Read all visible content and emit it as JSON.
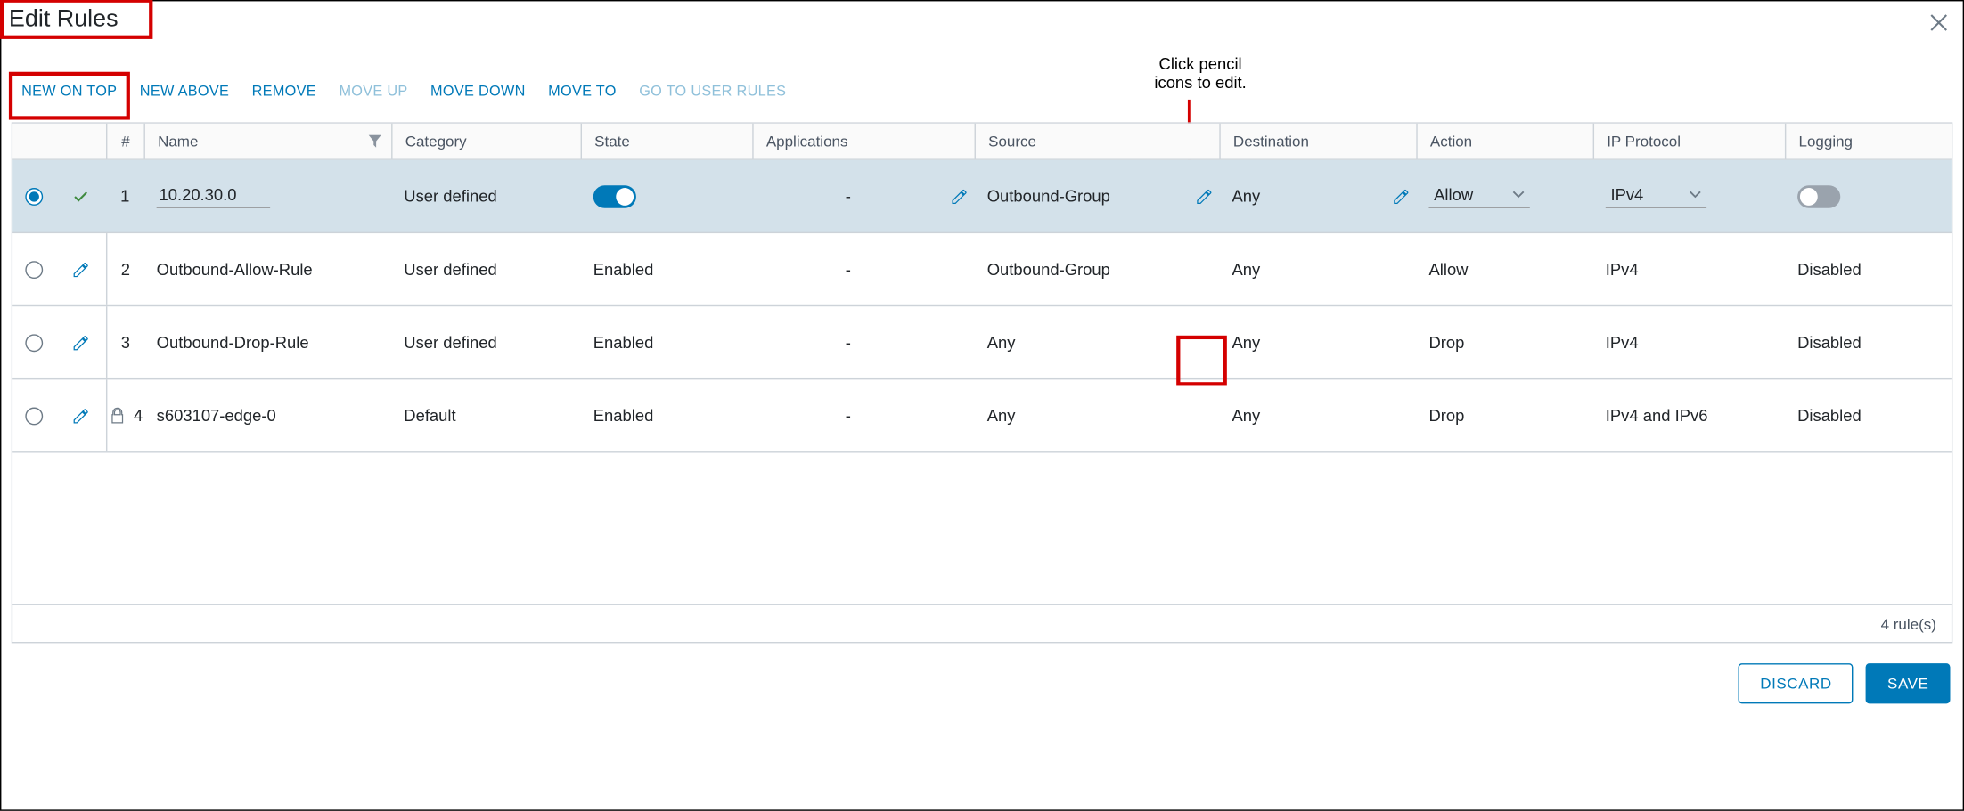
{
  "title": "Edit Rules",
  "annotation": {
    "callout_line1": "Click pencil",
    "callout_line2": "icons to edit."
  },
  "toolbar": {
    "new_on_top": {
      "label": "NEW ON TOP",
      "enabled": true
    },
    "new_above": {
      "label": "NEW ABOVE",
      "enabled": true
    },
    "remove": {
      "label": "REMOVE",
      "enabled": true
    },
    "move_up": {
      "label": "MOVE UP",
      "enabled": false
    },
    "move_down": {
      "label": "MOVE DOWN",
      "enabled": true
    },
    "move_to": {
      "label": "MOVE TO",
      "enabled": true
    },
    "go_to_user": {
      "label": "GO TO USER RULES",
      "enabled": false
    }
  },
  "columns": {
    "num": "#",
    "name": "Name",
    "category": "Category",
    "state": "State",
    "applications": "Applications",
    "source": "Source",
    "destination": "Destination",
    "action": "Action",
    "ip_protocol": "IP Protocol",
    "logging": "Logging"
  },
  "rows": [
    {
      "selected": true,
      "editing": true,
      "num": "1",
      "name": "10.20.30.0",
      "category": "User defined",
      "state_on": true,
      "state_label": "",
      "applications": "-",
      "source": "Outbound-Group",
      "destination": "Any",
      "action": "Allow",
      "ip_protocol": "IPv4",
      "logging_on": false,
      "logging_label": "",
      "locked": false
    },
    {
      "selected": false,
      "editing": false,
      "num": "2",
      "name": "Outbound-Allow-Rule",
      "category": "User defined",
      "state_label": "Enabled",
      "applications": "-",
      "source": "Outbound-Group",
      "destination": "Any",
      "action": "Allow",
      "ip_protocol": "IPv4",
      "logging_label": "Disabled",
      "locked": false
    },
    {
      "selected": false,
      "editing": false,
      "num": "3",
      "name": "Outbound-Drop-Rule",
      "category": "User defined",
      "state_label": "Enabled",
      "applications": "-",
      "source": "Any",
      "destination": "Any",
      "action": "Drop",
      "ip_protocol": "IPv4",
      "logging_label": "Disabled",
      "locked": false
    },
    {
      "selected": false,
      "editing": false,
      "num": "4",
      "name": "s603107-edge-0",
      "category": "Default",
      "state_label": "Enabled",
      "applications": "-",
      "source": "Any",
      "destination": "Any",
      "action": "Drop",
      "ip_protocol": "IPv4 and IPv6",
      "logging_label": "Disabled",
      "locked": true
    }
  ],
  "footer": {
    "count_label": "4 rule(s)",
    "discard": "DISCARD",
    "save": "SAVE"
  }
}
